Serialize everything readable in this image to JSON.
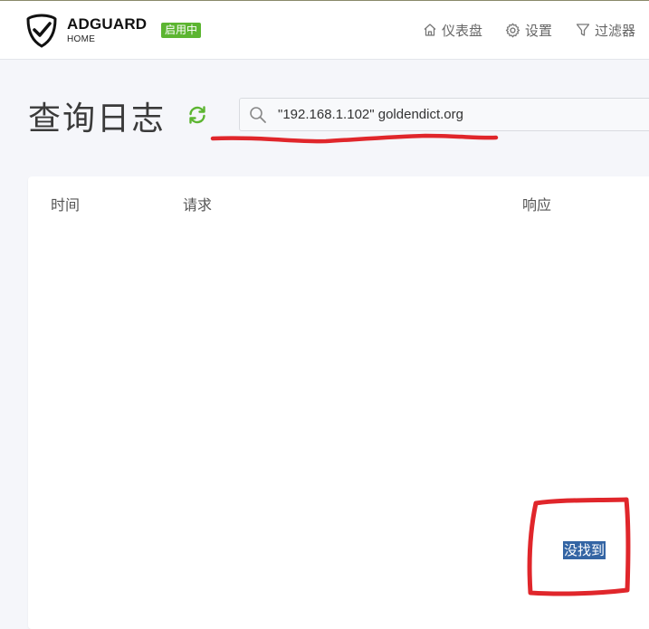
{
  "header": {
    "brand_name": "ADGUARD",
    "brand_sub": "HOME",
    "status_badge": "启用中",
    "nav": {
      "dashboard": "仪表盘",
      "settings": "设置",
      "filters": "过滤器"
    }
  },
  "main": {
    "title": "查询日志",
    "search": {
      "value": "\"192.168.1.102\" goldendict.org"
    },
    "table": {
      "columns": [
        "时间",
        "请求",
        "响应"
      ],
      "empty_text": "没找到"
    }
  },
  "colors": {
    "accent_green": "#5cb531",
    "annotation_red": "#e0262b",
    "selection_blue": "#3465a4"
  },
  "icons": [
    "adguard-shield-icon",
    "home-icon",
    "gear-icon",
    "filter-icon",
    "refresh-icon",
    "search-icon"
  ]
}
